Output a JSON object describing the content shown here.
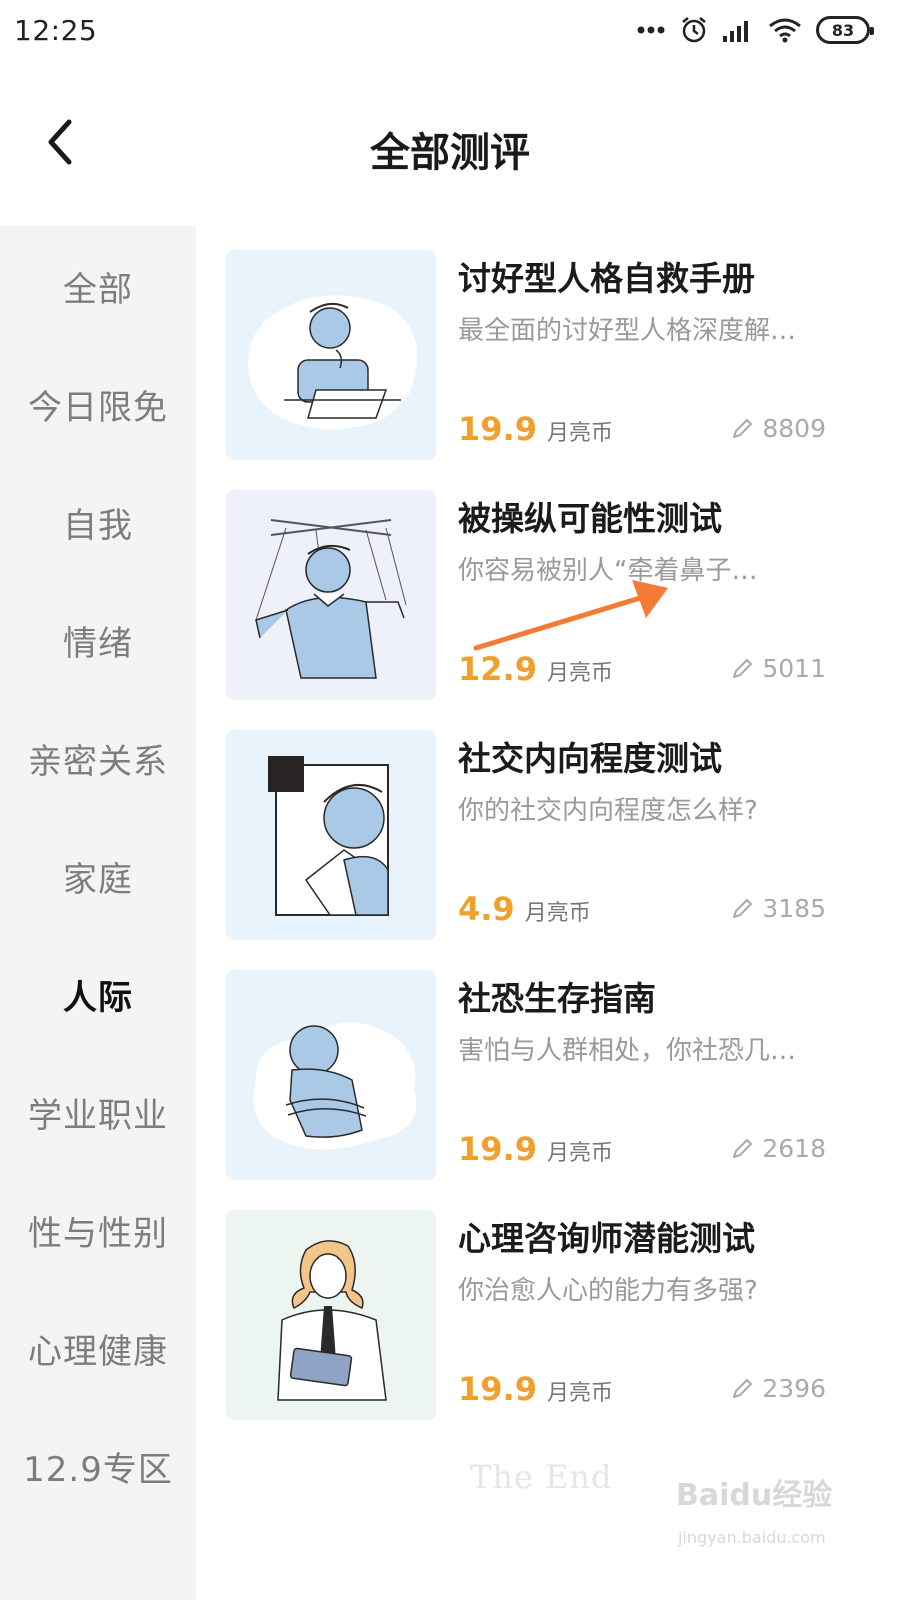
{
  "status_bar": {
    "time": "12:25",
    "battery": "83"
  },
  "header": {
    "title": "全部测评"
  },
  "sidebar": {
    "items": [
      {
        "label": "全部",
        "active": false
      },
      {
        "label": "今日限免",
        "active": false
      },
      {
        "label": "自我",
        "active": false
      },
      {
        "label": "情绪",
        "active": false
      },
      {
        "label": "亲密关系",
        "active": false
      },
      {
        "label": "家庭",
        "active": false
      },
      {
        "label": "人际",
        "active": true
      },
      {
        "label": "学业职业",
        "active": false
      },
      {
        "label": "性与性别",
        "active": false
      },
      {
        "label": "心理健康",
        "active": false
      },
      {
        "label": "12.9专区",
        "active": false
      }
    ]
  },
  "tests": [
    {
      "title": "讨好型人格自救手册",
      "desc": "最全面的讨好型人格深度解…",
      "price": "19.9",
      "unit": "月亮币",
      "count": "8809"
    },
    {
      "title": "被操纵可能性测试",
      "desc": "你容易被别人“牵着鼻子…",
      "price": "12.9",
      "unit": "月亮币",
      "count": "5011"
    },
    {
      "title": "社交内向程度测试",
      "desc": "你的社交内向程度怎么样?",
      "price": "4.9",
      "unit": "月亮币",
      "count": "3185"
    },
    {
      "title": "社恐生存指南",
      "desc": "害怕与人群相处，你社恐几…",
      "price": "19.9",
      "unit": "月亮币",
      "count": "2618"
    },
    {
      "title": "心理咨询师潜能测试",
      "desc": "你治愈人心的能力有多强?",
      "price": "19.9",
      "unit": "月亮币",
      "count": "2396"
    }
  ],
  "footer": {
    "end_text": "The End"
  },
  "watermark": {
    "logo": "Baidu经验",
    "url": "jingyan.baidu.com"
  },
  "colors": {
    "accent": "#f0a12b",
    "arrow": "#f47a35",
    "figure": "#a9c9e6"
  }
}
